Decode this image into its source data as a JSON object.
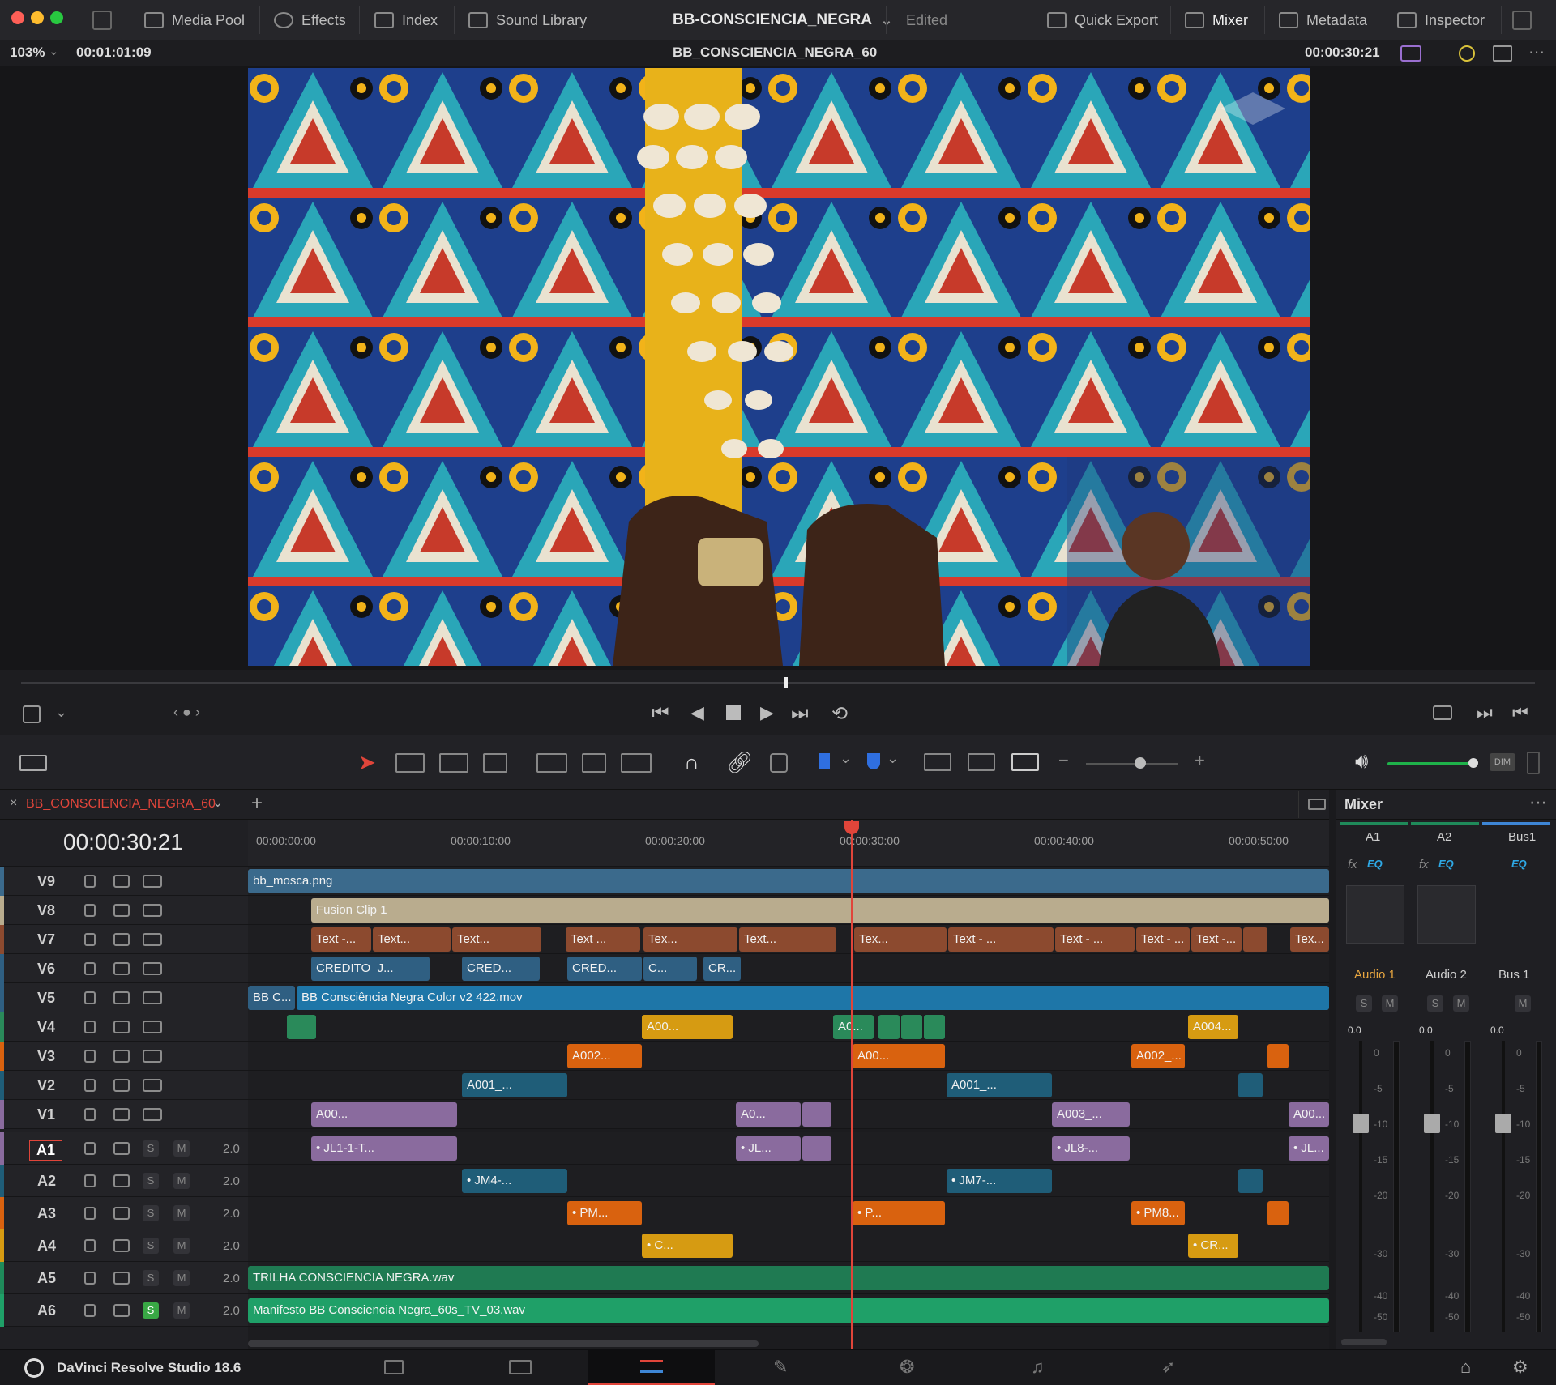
{
  "topbar": {
    "media_pool": "Media Pool",
    "effects": "Effects",
    "index": "Index",
    "sound_library": "Sound Library",
    "project_title": "BB-CONSCIENCIA_NEGRA",
    "status": "Edited",
    "quick_export": "Quick Export",
    "mixer": "Mixer",
    "metadata": "Metadata",
    "inspector": "Inspector"
  },
  "viewerbar": {
    "zoom": "103%",
    "source_tc": "00:01:01:09",
    "timeline_name": "BB_CONSCIENCIA_NEGRA_60",
    "record_tc": "00:00:30:21"
  },
  "timeline": {
    "tab_name": "BB_CONSCIENCIA_NEGRA_60",
    "timecode": "00:00:30:21",
    "ruler": [
      "00:00:00:00",
      "00:00:10:00",
      "00:00:20:00",
      "00:00:30:00",
      "00:00:40:00",
      "00:00:50:00"
    ],
    "video_tracks": [
      "V9",
      "V8",
      "V7",
      "V6",
      "V5",
      "V4",
      "V3",
      "V2",
      "V1"
    ],
    "audio_tracks": [
      "A1",
      "A2",
      "A3",
      "A4",
      "A5",
      "A6"
    ],
    "audio_levels": [
      "2.0",
      "2.0",
      "2.0",
      "2.0",
      "2.0",
      "2.0"
    ],
    "solo": "S",
    "mute": "M",
    "clips": {
      "v9": "bb_mosca.png",
      "v8": "Fusion Clip 1",
      "v7": [
        "Text -...",
        "Text...",
        "Text...",
        "Text ...",
        "Tex...",
        "Text...",
        "Tex...",
        "Text - ...",
        "Text - ...",
        "Text - ...",
        "Text -...",
        "Tex..."
      ],
      "v6": [
        "CREDITO_J...",
        "CRED...",
        "CRED...",
        "C...",
        "CR..."
      ],
      "v5a": "BB C...",
      "v5b": "BB Consciência Negra Color v2 422.mov",
      "v4": [
        "A00...",
        "A0...",
        "A004..."
      ],
      "v3": [
        "A002...",
        "A00...",
        "A002_..."
      ],
      "v2": [
        "A001_...",
        "A001_..."
      ],
      "v1": [
        "A00...",
        "A0...",
        "A003_...",
        "A00..."
      ],
      "a1": [
        "• JL1-1-T...",
        "• JL...",
        "• JL8-...",
        "• JL..."
      ],
      "a2": [
        "• JM4-...",
        "• JM7-..."
      ],
      "a3": [
        "• PM...",
        "• P...",
        "• PM8..."
      ],
      "a4": [
        "• C...",
        "• CR..."
      ],
      "a5": "TRILHA CONSCIENCIA NEGRA.wav",
      "a6": "Manifesto BB Consciencia Negra_60s_TV_03.wav"
    }
  },
  "mixer": {
    "title": "Mixer",
    "channels": [
      "A1",
      "A2",
      "Bus1"
    ],
    "fx": "fx",
    "eq": "EQ",
    "names": [
      "Audio 1",
      "Audio 2",
      "Bus 1"
    ],
    "levels": [
      "0.0",
      "0.0",
      "0.0"
    ],
    "scale": [
      "0",
      "-5",
      "-10",
      "-15",
      "-20",
      "-30",
      "-40",
      "-50"
    ]
  },
  "app": {
    "name": "DaVinci Resolve Studio 18.6"
  },
  "colors": {
    "accent_red": "#e0453a",
    "text_clip": "#8c4a2f",
    "video_blue": "#3b6a8c",
    "audio_green": "#1f8a5a",
    "fusion_tan": "#b9ac8e",
    "orange": "#d9620f",
    "yellow": "#d69b12",
    "purple": "#8a6b9e",
    "teal": "#1f5d78"
  }
}
